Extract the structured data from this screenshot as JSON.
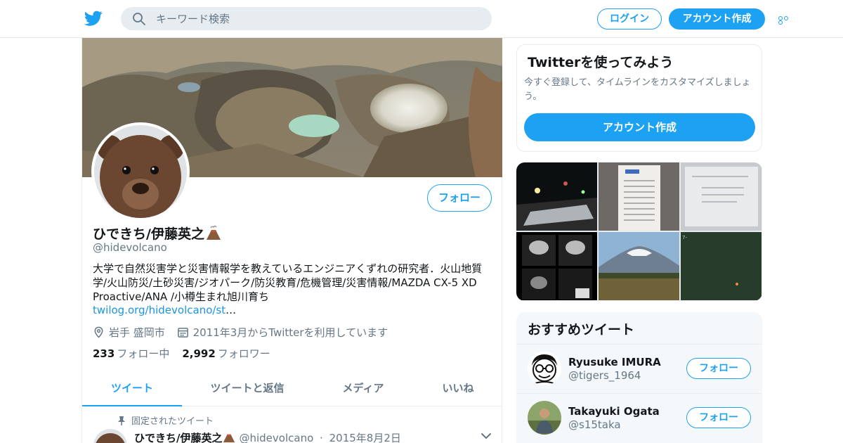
{
  "colors": {
    "brand": "#1da1f2",
    "link": "#1b95e0",
    "muted": "#657786",
    "text": "#14171a",
    "border": "#e6ecf0"
  },
  "topbar": {
    "logo_icon": "twitter-bird-icon",
    "search_icon": "search-icon",
    "search_placeholder": "キーワード検索",
    "login_label": "ログイン",
    "signup_label": "アカウント作成",
    "more_icon": "more-dots-icon"
  },
  "profile": {
    "name": "ひできち/伊藤英之",
    "name_emoji_icon": "volcano-icon",
    "handle": "@hidevolcano",
    "follow_label": "フォロー",
    "bio": "大学で自然災害学と災害情報学を教えているエンジニアくずれの研究者．火山地質学/火山防災/土砂災害/ジオパーク/防災教育/危機管理/災害情報/MAZDA CX-5 XD Proactive/ANA /小樽生まれ旭川育ち",
    "bio_link": "twilog.org/hidevolcano/st",
    "bio_link_ellipsis": "…",
    "location_icon": "location-pin-icon",
    "location": "岩手 盛岡市",
    "joined_icon": "calendar-icon",
    "joined": "2011年3月からTwitterを利用しています",
    "following_count": "233",
    "following_label": "フォロー中",
    "followers_count": "2,992",
    "followers_label": "フォロワー",
    "tabs": [
      "ツイート",
      "ツイートと返信",
      "メディア",
      "いいね"
    ],
    "active_tab": 0
  },
  "pinned_tweet": {
    "pin_icon": "pin-icon",
    "label": "固定されたツイート",
    "name": "ひできち/伊藤英之",
    "handle": "@hidevolcano",
    "date": "2015年8月2日",
    "separator": "·",
    "caret_icon": "chevron-down-icon"
  },
  "signup_card": {
    "title": "Twitterを使ってみよう",
    "text": "今すぐ登録して、タイムラインをカスタマイズしましょう。",
    "button_label": "アカウント作成"
  },
  "media_grid": {
    "items": [
      "night-street-photo",
      "receipt-photo",
      "document-photo",
      "radar-images-photo",
      "mount-iwate-photo",
      "dark-green-photo"
    ]
  },
  "recommended": {
    "title": "おすすめツイート",
    "users": [
      {
        "name": "Ryusuke IMURA",
        "handle": "@tigers_1964",
        "follow_label": "フォロー",
        "avatar_icon": "cartoon-face-avatar"
      },
      {
        "name": "Takayuki Ogata",
        "handle": "@s15taka",
        "follow_label": "フォロー",
        "avatar_icon": "photo-avatar"
      }
    ]
  }
}
